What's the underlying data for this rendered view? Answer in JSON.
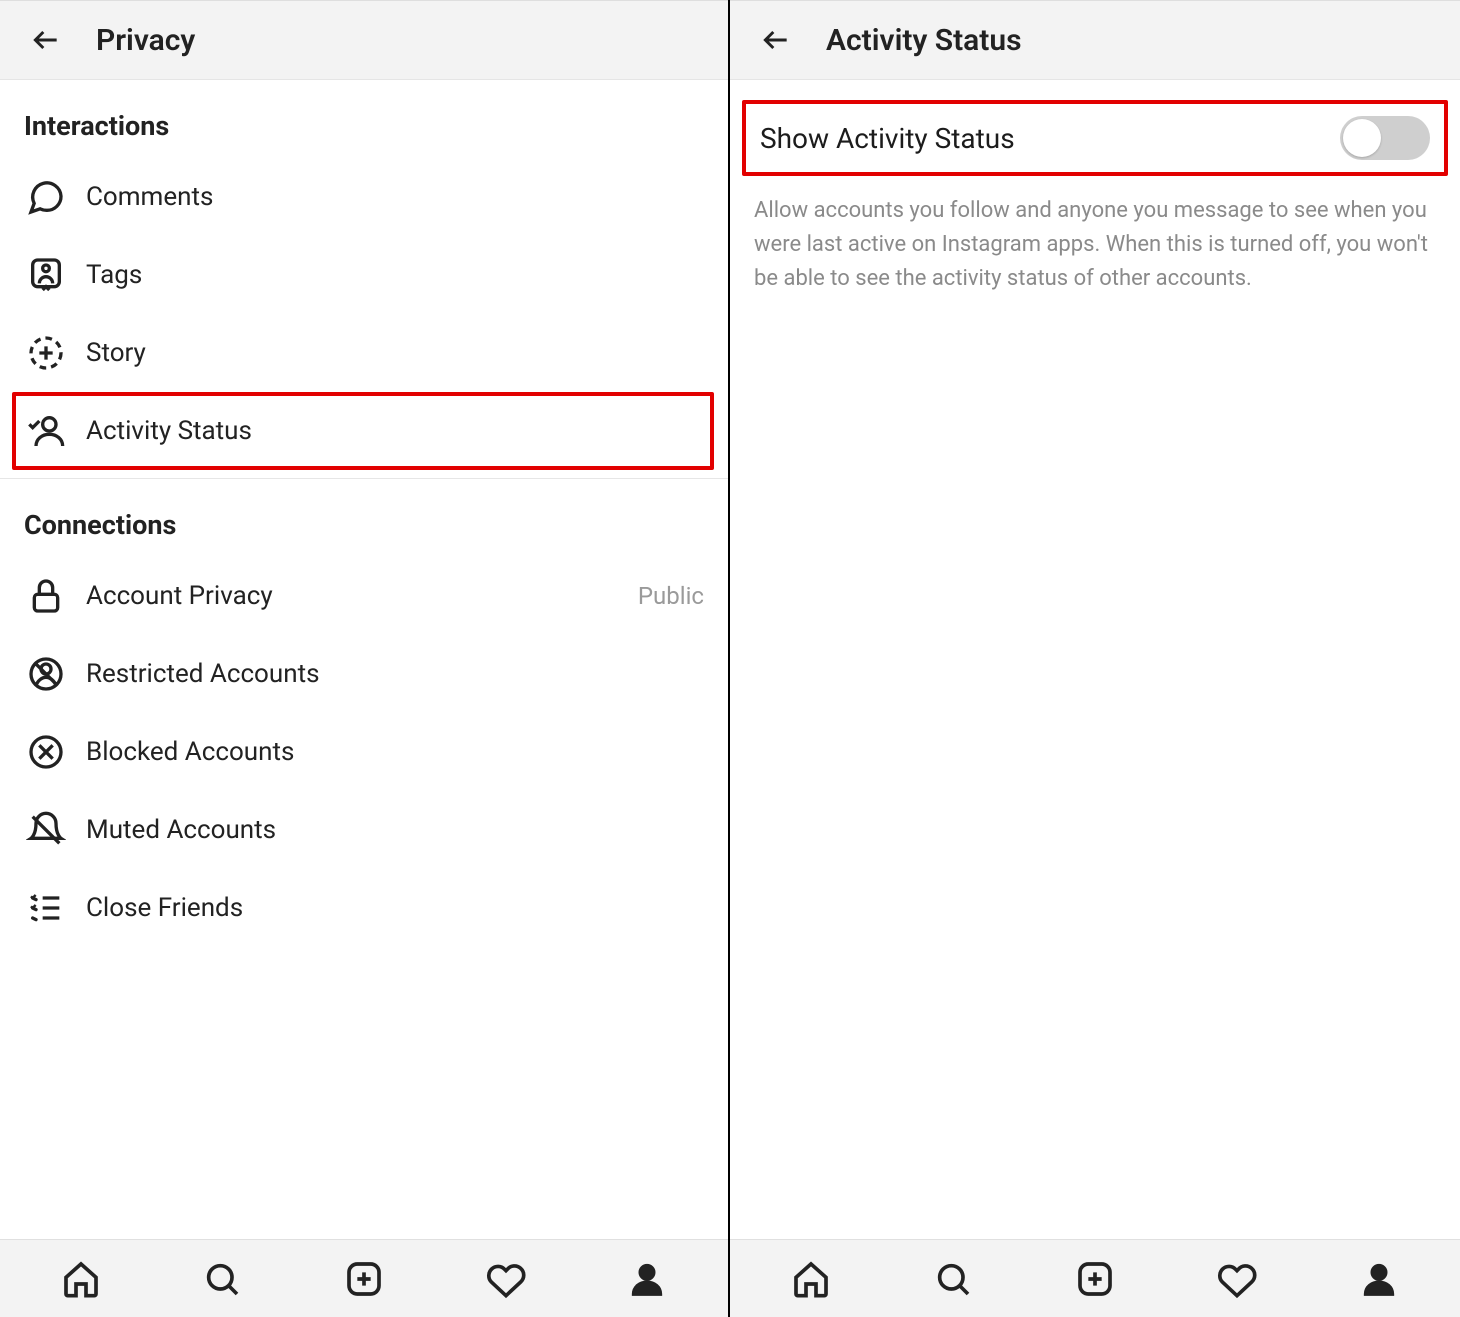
{
  "left": {
    "title": "Privacy",
    "sections": {
      "interactions": {
        "title": "Interactions",
        "items": {
          "comments": "Comments",
          "tags": "Tags",
          "story": "Story",
          "activity_status": "Activity Status"
        }
      },
      "connections": {
        "title": "Connections",
        "items": {
          "account_privacy": {
            "label": "Account Privacy",
            "value": "Public"
          },
          "restricted": "Restricted Accounts",
          "blocked": "Blocked Accounts",
          "muted": "Muted Accounts",
          "close_friends": "Close Friends"
        }
      }
    }
  },
  "right": {
    "title": "Activity Status",
    "toggle": {
      "label": "Show Activity Status",
      "on": false
    },
    "description": "Allow accounts you follow and anyone you message to see when you were last active on Instagram apps. When this is turned off, you won't be able to see the activity status of other accounts."
  }
}
